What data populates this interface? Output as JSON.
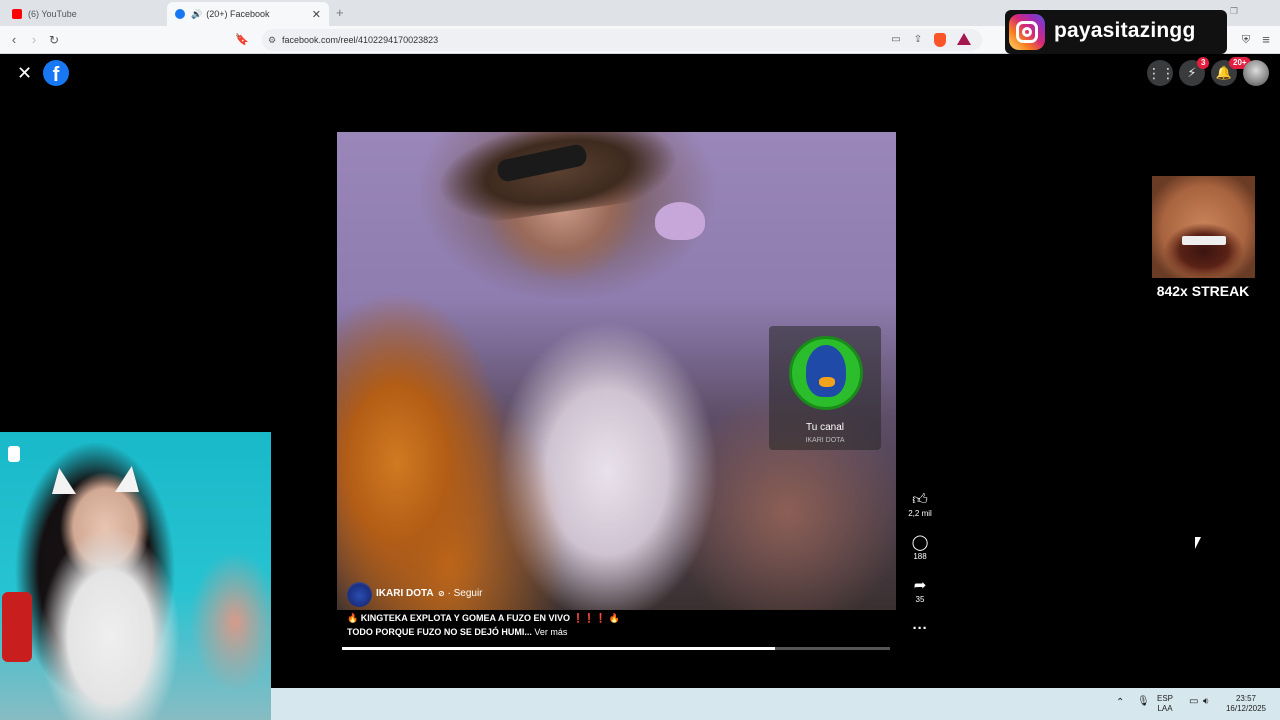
{
  "browser": {
    "tabs": [
      {
        "label": "(6) YouTube",
        "active": false
      },
      {
        "label": "(20+) Facebook",
        "active": true
      }
    ],
    "url": "facebook.com/reel/4102294170023823",
    "colors": {
      "youtube": "#ff0000",
      "facebook": "#1877f2"
    }
  },
  "instagram_overlay": {
    "handle": "payasitazingg"
  },
  "facebook": {
    "messenger_badge": "3",
    "notifications_badge": "20+"
  },
  "streak_overlay": {
    "text": "842x STREAK"
  },
  "reel": {
    "channel_card": {
      "title": "Tu canal",
      "subtitle": "IKARI DOTA"
    },
    "author": "IKARI DOTA",
    "follow_label": "· Seguir",
    "caption_line1": "🔥 KINGTEKA EXPLOTA Y GOMEA A FUZO EN VIVO ❗❗❗ 🔥",
    "caption_line2": "TODO PORQUE FUZO NO SE DEJÓ HUMI...",
    "see_more": "Ver más",
    "progress": 0.79,
    "likes": "2,2 mil",
    "comments": "188",
    "shares": "35"
  },
  "taskbar": {
    "lang_top": "ESP",
    "lang_bottom": "LAA",
    "time": "23:57",
    "date": "16/12/2025"
  }
}
